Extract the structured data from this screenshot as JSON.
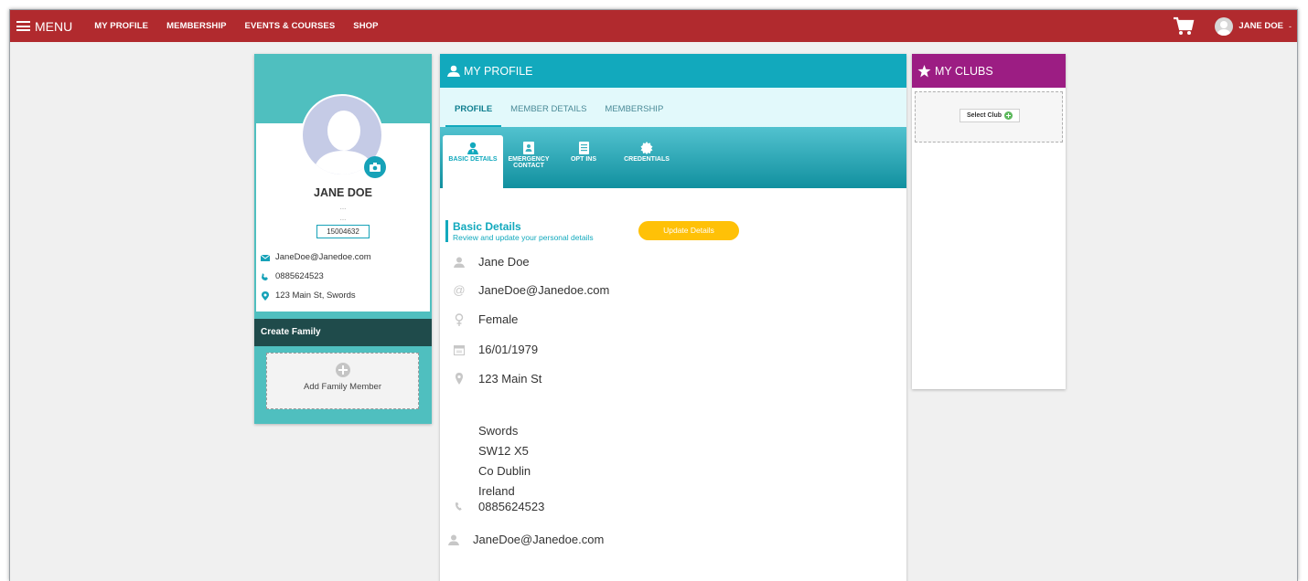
{
  "topnav": {
    "menu_label": "MENU",
    "links": [
      "MY PROFILE",
      "MEMBERSHIP",
      "EVENTS & COURSES",
      "SHOP"
    ],
    "user_name": "JANE DOE",
    "user_caret": "-",
    "cart_icon": "shopping-cart-icon"
  },
  "profile_card": {
    "name": "JANE DOE",
    "dots1": "...",
    "dots2": "...",
    "member_id": "15004632",
    "email": "JaneDoe@Janedoe.com",
    "phone": "0885624523",
    "address": "123 Main St, Swords",
    "family_heading": "Create Family",
    "add_family_label": "Add Family Member"
  },
  "main": {
    "title": "MY PROFILE",
    "tabs": [
      "PROFILE",
      "MEMBER DETAILS",
      "MEMBERSHIP"
    ],
    "subtabs": [
      {
        "label": "BASIC DETAILS"
      },
      {
        "label": "EMERGENCY",
        "label2": "CONTACT"
      },
      {
        "label": "OPT INS"
      },
      {
        "label": "CREDENTIALS"
      }
    ],
    "section_title": "Basic Details",
    "section_subtitle": "Review and update your personal details",
    "update_button": "Update Details",
    "details": {
      "name": "Jane Doe",
      "email": "JaneDoe@Janedoe.com",
      "gender": "Female",
      "dob": "16/01/1979",
      "address1": "123 Main St",
      "address_city": "Swords",
      "address_postcode": "SW12 X5",
      "address_county": "Co Dublin",
      "address_country": "Ireland",
      "phone": "0885624523",
      "emergency_email": "JaneDoe@Janedoe.com"
    }
  },
  "clubs": {
    "title": "MY CLUBS",
    "select_label": "Select Club"
  },
  "colors": {
    "topbar": "#b12a2e",
    "teal": "#12a9bd",
    "purple": "#9c1d83",
    "yellow": "#ffc107"
  }
}
